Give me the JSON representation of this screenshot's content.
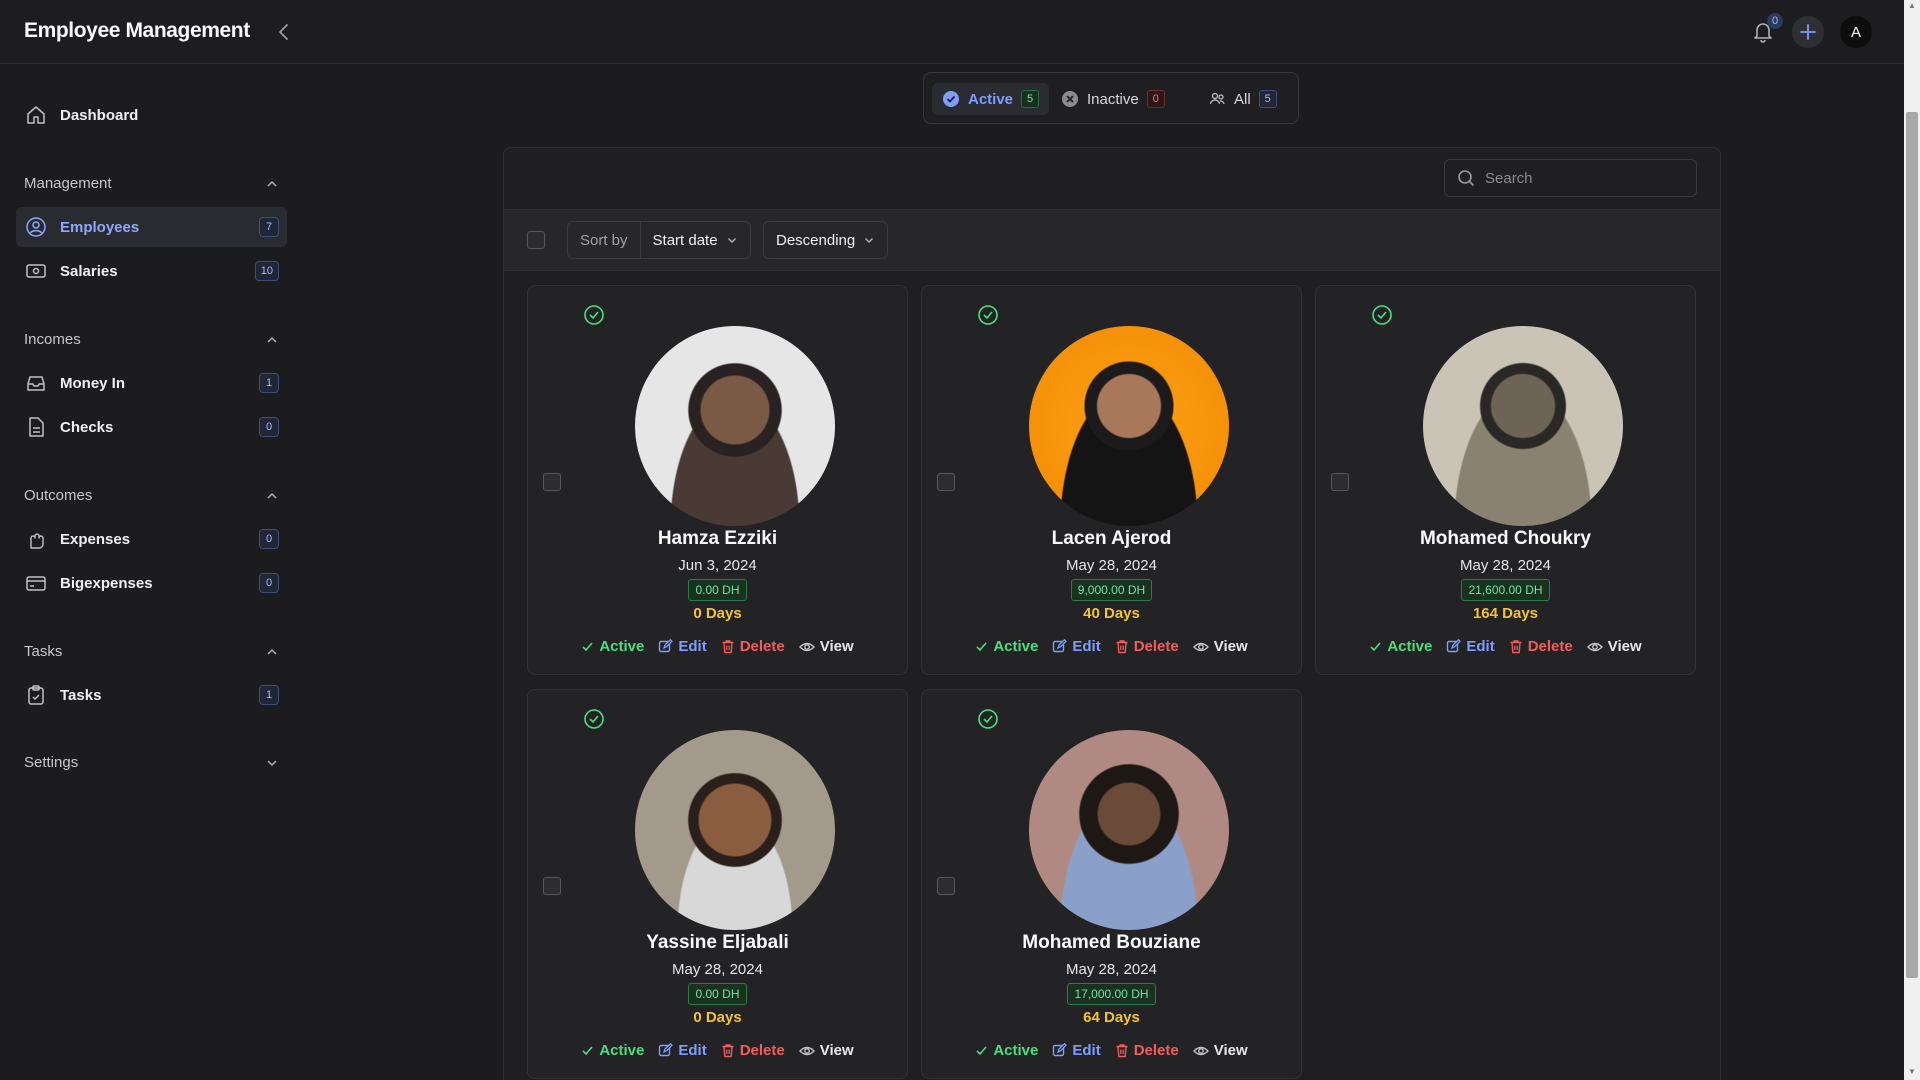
{
  "header": {
    "title": "Employee Management",
    "notification_count": "0",
    "avatar_initial": "A"
  },
  "sidebar": {
    "dashboard": "Dashboard",
    "sections": {
      "management": "Management",
      "incomes": "Incomes",
      "outcomes": "Outcomes",
      "tasks": "Tasks",
      "settings": "Settings"
    },
    "items": {
      "employees": {
        "label": "Employees",
        "count": "7"
      },
      "salaries": {
        "label": "Salaries",
        "count": "10"
      },
      "money_in": {
        "label": "Money In",
        "count": "1"
      },
      "checks": {
        "label": "Checks",
        "count": "0"
      },
      "expenses": {
        "label": "Expenses",
        "count": "0"
      },
      "bigexpenses": {
        "label": "Bigexpenses",
        "count": "0"
      },
      "tasks": {
        "label": "Tasks",
        "count": "1"
      }
    }
  },
  "status_tabs": {
    "active": {
      "label": "Active",
      "count": "5"
    },
    "inactive": {
      "label": "Inactive",
      "count": "0"
    },
    "all": {
      "label": "All",
      "count": "5"
    }
  },
  "search": {
    "placeholder": "Search"
  },
  "sort": {
    "label": "Sort by",
    "field": "Start date",
    "order": "Descending"
  },
  "card_actions": {
    "status": "Active",
    "edit": "Edit",
    "delete": "Delete",
    "view": "View"
  },
  "employees": [
    {
      "name": "Hamza Ezziki",
      "date": "Jun 3, 2024",
      "salary": "0.00 DH",
      "days": "0 Days"
    },
    {
      "name": "Lacen Ajerod",
      "date": "May 28, 2024",
      "salary": "9,000.00 DH",
      "days": "40 Days"
    },
    {
      "name": "Mohamed Choukry",
      "date": "May 28, 2024",
      "salary": "21,600.00 DH",
      "days": "164 Days"
    },
    {
      "name": "Yassine Eljabali",
      "date": "May 28, 2024",
      "salary": "0.00 DH",
      "days": "0 Days"
    },
    {
      "name": "Mohamed Bouziane",
      "date": "May 28, 2024",
      "salary": "17,000.00 DH",
      "days": "64 Days"
    }
  ],
  "colors": {
    "accent": "#7e9dff",
    "success": "#4ade80",
    "danger": "#f25c5c",
    "warning": "#f4c430"
  }
}
